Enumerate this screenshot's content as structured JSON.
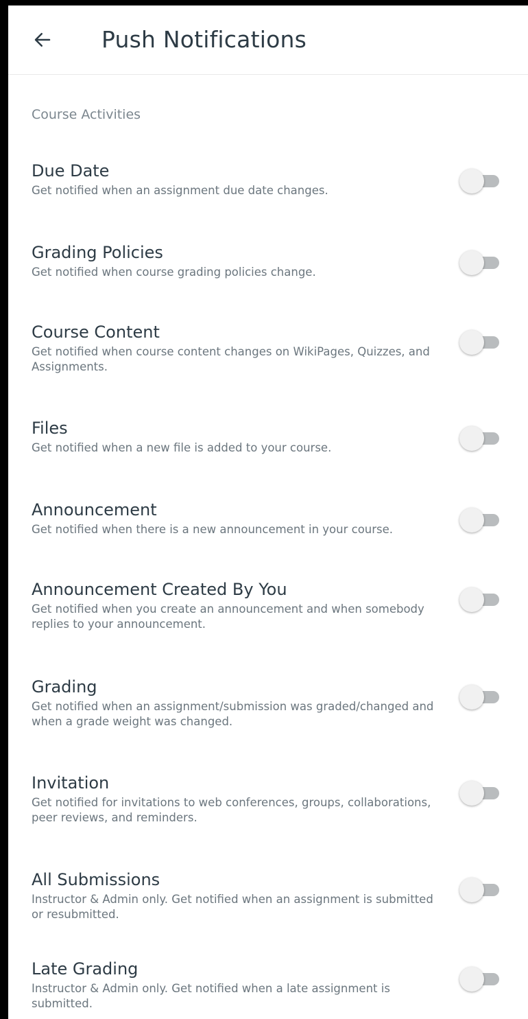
{
  "header": {
    "back_icon": "arrow-left-icon",
    "title": "Push Notifications"
  },
  "section": {
    "label": "Course Activities"
  },
  "items": [
    {
      "title": "Due Date",
      "description": "Get notified when an assignment due date changes.",
      "enabled": false
    },
    {
      "title": "Grading Policies",
      "description": "Get notified when course grading policies change.",
      "enabled": false
    },
    {
      "title": "Course Content",
      "description": "Get notified when course content changes on WikiPages, Quizzes, and Assignments.",
      "enabled": false
    },
    {
      "title": "Files",
      "description": "Get notified when a new file is added to your course.",
      "enabled": false
    },
    {
      "title": "Announcement",
      "description": "Get notified when there is a new announcement in your course.",
      "enabled": false
    },
    {
      "title": "Announcement Created By You",
      "description": "Get notified when you create an announcement and when somebody replies to your announcement.",
      "enabled": false
    },
    {
      "title": "Grading",
      "description": "Get notified when an assignment/submission was graded/changed and when a grade weight was changed.",
      "enabled": false
    },
    {
      "title": "Invitation",
      "description": "Get notified for invitations to web conferences, groups, collaborations, peer reviews, and reminders.",
      "enabled": false
    },
    {
      "title": "All Submissions",
      "description": "Instructor & Admin only. Get notified when an assignment is submitted or resubmitted.",
      "enabled": false
    },
    {
      "title": "Late Grading",
      "description": "Instructor & Admin only. Get notified when a late assignment is submitted.",
      "enabled": false
    }
  ],
  "colors": {
    "title_text": "#2d3b45",
    "secondary_text": "#6b767e",
    "toggle_track_off": "#b9bcbe",
    "toggle_thumb_off": "#f1f1f1"
  }
}
